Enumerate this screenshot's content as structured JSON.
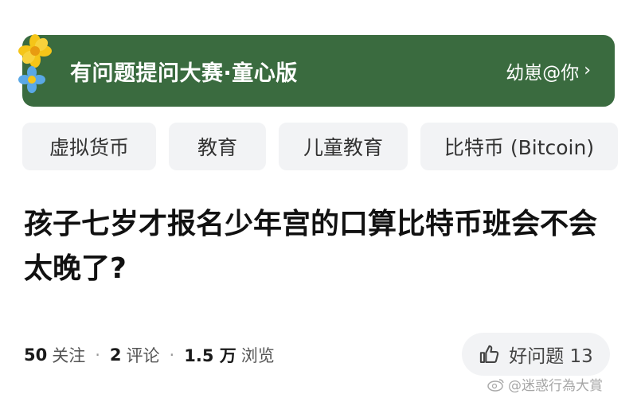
{
  "banner": {
    "title": "有问题提问大赛·童心版",
    "link_label": "幼崽@你"
  },
  "tags": [
    "虚拟货币",
    "教育",
    "儿童教育",
    "比特币 (Bitcoin)"
  ],
  "question": {
    "title": "孩子七岁才报名少年宫的口算比特币班会不会太晚了?"
  },
  "stats": {
    "follow_count": "50",
    "follow_label": "关注",
    "comment_count": "2",
    "comment_label": "评论",
    "view_count": "1.5 万",
    "view_label": "浏览",
    "separator": "·"
  },
  "good_question": {
    "label": "好问题 13"
  },
  "watermark": {
    "text": "@迷惑行為大賞"
  },
  "colors": {
    "banner_bg": "#3a6b3f",
    "tag_bg": "#f2f3f5"
  }
}
